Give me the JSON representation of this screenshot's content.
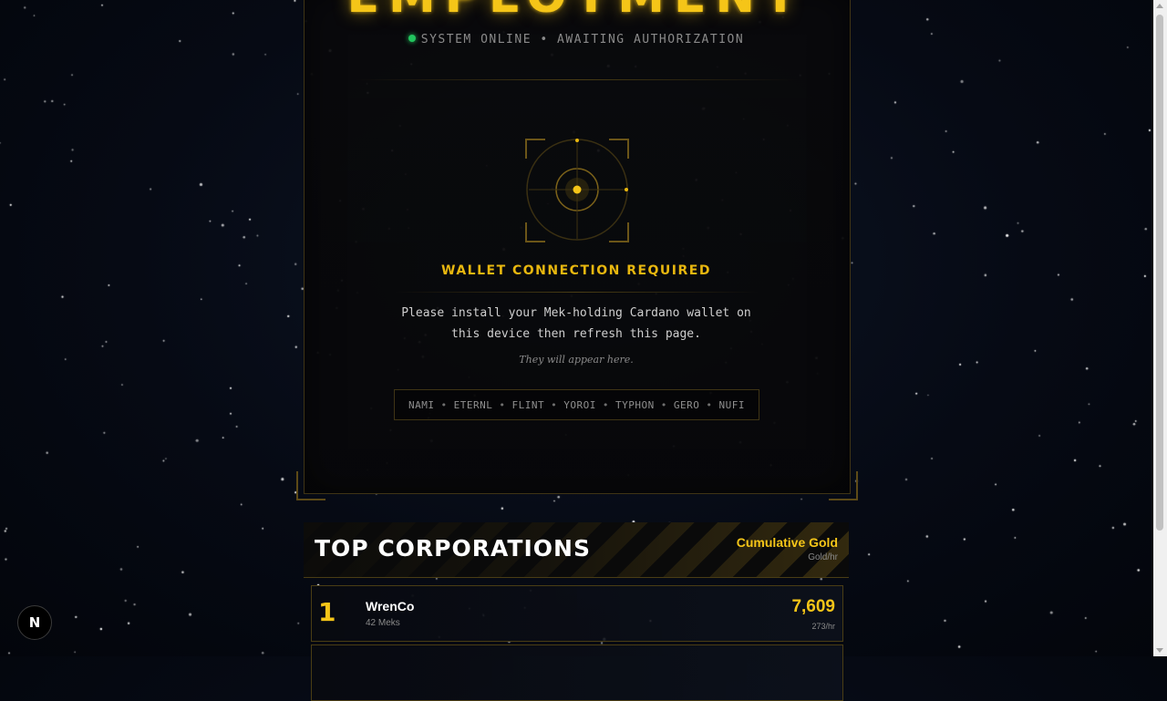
{
  "header": {
    "title": "EMPLOYMENT",
    "status_text": "SYSTEM ONLINE • AWAITING AUTHORIZATION",
    "status_color": "#22c55e"
  },
  "wallet_prompt": {
    "icon": "target-reticle-icon",
    "title": "WALLET CONNECTION REQUIRED",
    "message": "Please install your Mek-holding Cardano wallet on this device then refresh this page.",
    "hint": "They will appear here.",
    "wallets": [
      "NAMI",
      "ETERNL",
      "FLINT",
      "YOROI",
      "TYPHON",
      "GERO",
      "NUFI"
    ]
  },
  "leaderboard": {
    "title": "TOP CORPORATIONS",
    "metric_label": "Cumulative Gold",
    "metric_sub": "Gold/hr",
    "rows": [
      {
        "rank": "1",
        "name": "WrenCo",
        "meks": "42 Meks",
        "gold": "7,609",
        "rate": "273/hr"
      }
    ]
  },
  "badge": {
    "label": "N"
  },
  "colors": {
    "accent": "#f5c518",
    "border": "#4a3d14",
    "background": "#060a14"
  }
}
